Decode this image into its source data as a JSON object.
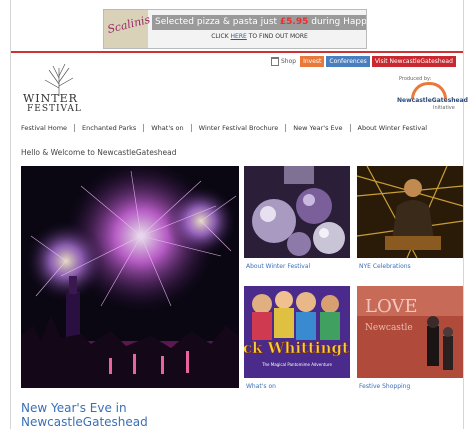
{
  "ad": {
    "brand": "Scalinis",
    "headline_prefix": "Selected pizza & pasta just ",
    "price": "£5.95",
    "headline_suffix": " during Happy Hour",
    "cta_prefix": "CLICK ",
    "cta_link": "HERE",
    "cta_suffix": " TO FIND OUT MORE"
  },
  "topbar": {
    "shop": "Shop",
    "invest": "Invest",
    "conferences": "Conferences",
    "visit": "Visit NewcastleGateshead"
  },
  "logo": {
    "line1": "WINTER",
    "line2": "FESTIVAL"
  },
  "partner": {
    "produced_by": "Produced by:",
    "name": "NewcastleGateshead",
    "sub": "Initiative"
  },
  "nav": [
    "Festival Home",
    "Enchanted Parks",
    "What's on",
    "Winter Festival Brochure",
    "New Year's Eve",
    "About Winter Festival"
  ],
  "welcome": "Hello & Welcome to NewcastleGateshead",
  "tiles": [
    {
      "caption": "About Winter Festival",
      "image": "baubles"
    },
    {
      "caption": "NYE Celebrations",
      "image": "dj"
    },
    {
      "caption": "What's on",
      "image": "pantomime",
      "poster_title": "Dick Whittington",
      "poster_sub": "The Magical Pantomime Adventure"
    },
    {
      "caption": "Festive Shopping",
      "image": "love-sign",
      "sign_line1": "LOVE",
      "sign_line2": "Newcastle"
    }
  ],
  "feature": {
    "line1": "New Year's Eve in",
    "line2": "NewcastleGateshead"
  },
  "colors": {
    "accent_red": "#c8282f",
    "link_blue": "#3a6fb7",
    "invest_orange": "#e8793a",
    "conf_blue": "#4a7fbf"
  }
}
